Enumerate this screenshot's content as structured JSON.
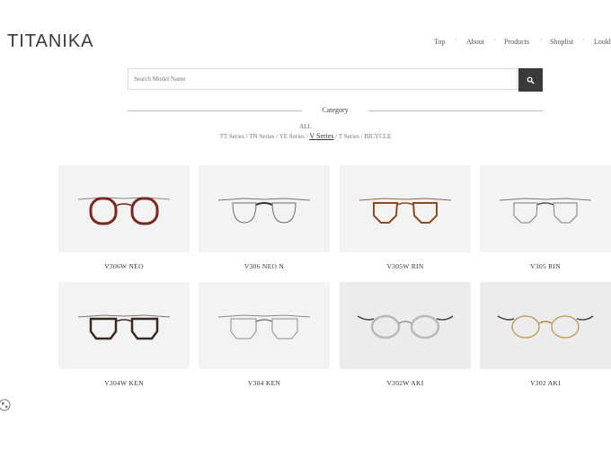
{
  "brand": {
    "logo": "TITANIKA"
  },
  "nav": {
    "items": [
      "Top",
      "About",
      "Products",
      "Shoplist",
      "Lookb"
    ]
  },
  "search": {
    "placeholder": "Search Model Name"
  },
  "category": {
    "heading": "Category",
    "all": "ALL",
    "series": [
      "TT Series",
      "TN Series",
      "YE Series",
      "V Series",
      "T Series",
      "BICYCLE"
    ],
    "active": "V Series"
  },
  "products": [
    {
      "name": "V306W NEO",
      "frame": "#7a2a1e"
    },
    {
      "name": "V306 NEO N",
      "frame": "#6d6d6d"
    },
    {
      "name": "V305W RIN",
      "frame": "#8a4a22"
    },
    {
      "name": "V305 RIN",
      "frame": "#7d7d7d"
    },
    {
      "name": "V304W KEN",
      "frame": "#3b2a22"
    },
    {
      "name": "V304 KEN",
      "frame": "#8c8c8c"
    },
    {
      "name": "V302W AKI",
      "frame": "#b9b9b9"
    },
    {
      "name": "V302 AKI",
      "frame": "#c0a36a"
    }
  ]
}
